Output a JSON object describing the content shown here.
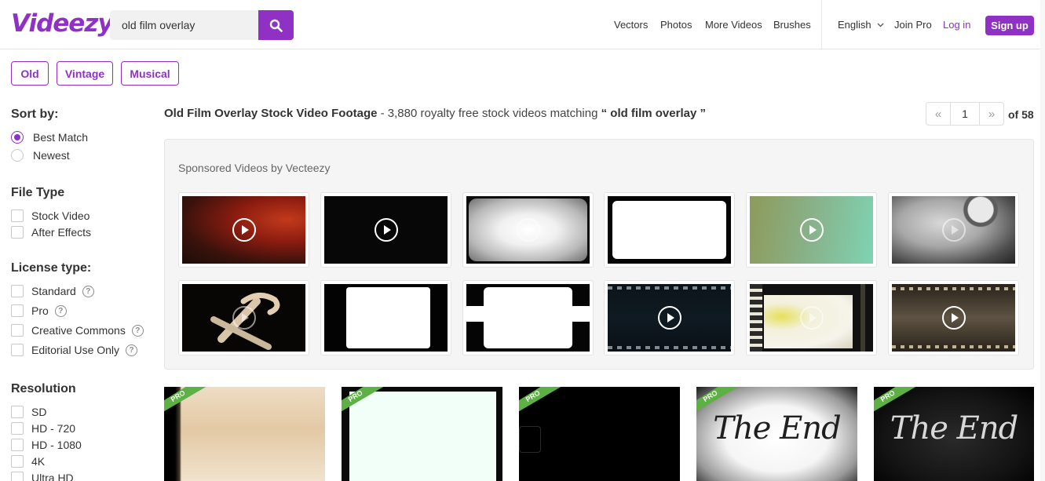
{
  "brand": {
    "logo_text": "Videezy",
    "accent": "#8e31c4"
  },
  "search": {
    "value": "old film overlay",
    "icon": "search-icon"
  },
  "nav": {
    "vectors": "Vectors",
    "photos": "Photos",
    "more_videos": "More Videos",
    "brushes": "Brushes",
    "language": "English",
    "join_pro": "Join Pro",
    "login": "Log in",
    "signup": "Sign up"
  },
  "tags": [
    "Old",
    "Vintage",
    "Musical"
  ],
  "sidebar": {
    "sort_heading": "Sort by:",
    "sort_options": [
      "Best Match",
      "Newest"
    ],
    "file_type_heading": "File Type",
    "file_types": [
      "Stock Video",
      "After Effects"
    ],
    "license_heading": "License type:",
    "licenses": [
      "Standard",
      "Pro",
      "Creative Commons",
      "Editorial Use Only"
    ],
    "resolution_heading": "Resolution",
    "resolutions": [
      "SD",
      "HD - 720",
      "HD - 1080",
      "4K",
      "Ultra HD"
    ],
    "help_symbol": "?"
  },
  "results": {
    "title": "Old Film Overlay Stock Video Footage",
    "summary": " - 3,880 royalty free stock videos matching ",
    "query_quoted": "“ old film overlay ”",
    "page": "1",
    "of_pages": "of 58",
    "prev_symbol": "«",
    "next_symbol": "»"
  },
  "sponsored": {
    "title": "Sponsored Videos by Vecteezy"
  },
  "pro_label": "PRO",
  "end_text": "The End"
}
